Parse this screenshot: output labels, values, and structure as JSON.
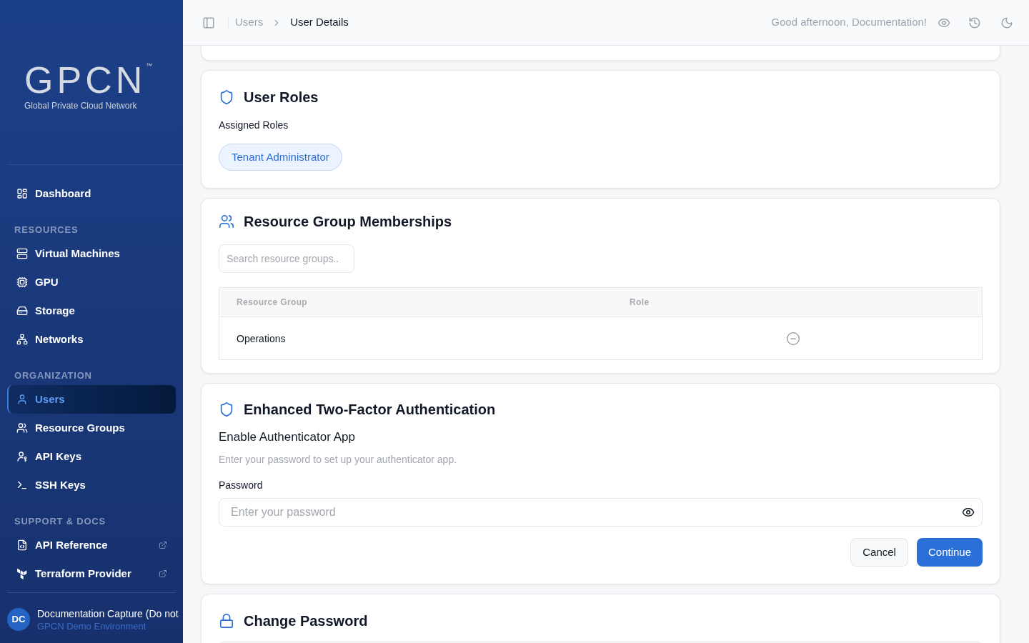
{
  "sidebar": {
    "logo": {
      "wordmark": "GPCN",
      "trademark": "™",
      "tagline": "Global Private Cloud Network"
    },
    "sections": [
      {
        "items": [
          {
            "label": "Dashboard",
            "selected": false,
            "external": false
          }
        ]
      },
      {
        "heading": "RESOURCES",
        "items": [
          {
            "label": "Virtual Machines",
            "selected": false,
            "external": false
          },
          {
            "label": "GPU",
            "selected": false,
            "external": false
          },
          {
            "label": "Storage",
            "selected": false,
            "external": false
          },
          {
            "label": "Networks",
            "selected": false,
            "external": false
          }
        ]
      },
      {
        "heading": "ORGANIZATION",
        "items": [
          {
            "label": "Users",
            "selected": true,
            "external": false
          },
          {
            "label": "Resource Groups",
            "selected": false,
            "external": false
          },
          {
            "label": "API Keys",
            "selected": false,
            "external": false
          },
          {
            "label": "SSH Keys",
            "selected": false,
            "external": false
          }
        ]
      },
      {
        "heading": "SUPPORT & DOCS",
        "items": [
          {
            "label": "API Reference",
            "selected": false,
            "external": true
          },
          {
            "label": "Terraform Provider",
            "selected": false,
            "external": true
          }
        ]
      }
    ],
    "user": {
      "initials": "DC",
      "name": "Documentation Capture (Do not",
      "environment": "GPCN Demo Environment"
    }
  },
  "header": {
    "breadcrumbs": [
      {
        "label": "Users",
        "current": false
      },
      {
        "label": "User Details",
        "current": true
      }
    ],
    "greeting": "Good afternoon, Documentation!"
  },
  "user_roles": {
    "title": "User Roles",
    "label": "Assigned Roles",
    "roles": [
      "Tenant Administrator"
    ]
  },
  "resource_groups": {
    "title": "Resource Group Memberships",
    "search": {
      "placeholder": "Search resource groups.."
    },
    "table": {
      "columns": [
        "Resource Group",
        "Role"
      ],
      "rows": [
        {
          "resource_group": "Operations"
        }
      ]
    }
  },
  "two_factor": {
    "title": "Enhanced Two-Factor Authentication",
    "subtitle": "Enable Authenticator App",
    "description": "Enter your password to set up your authenticator app.",
    "password": {
      "label": "Password",
      "placeholder": "Enter your password"
    },
    "buttons": [
      {
        "label": "Cancel",
        "kind": "secondary"
      },
      {
        "label": "Continue",
        "kind": "primary"
      }
    ]
  },
  "change_password": {
    "title": "Change Password"
  }
}
